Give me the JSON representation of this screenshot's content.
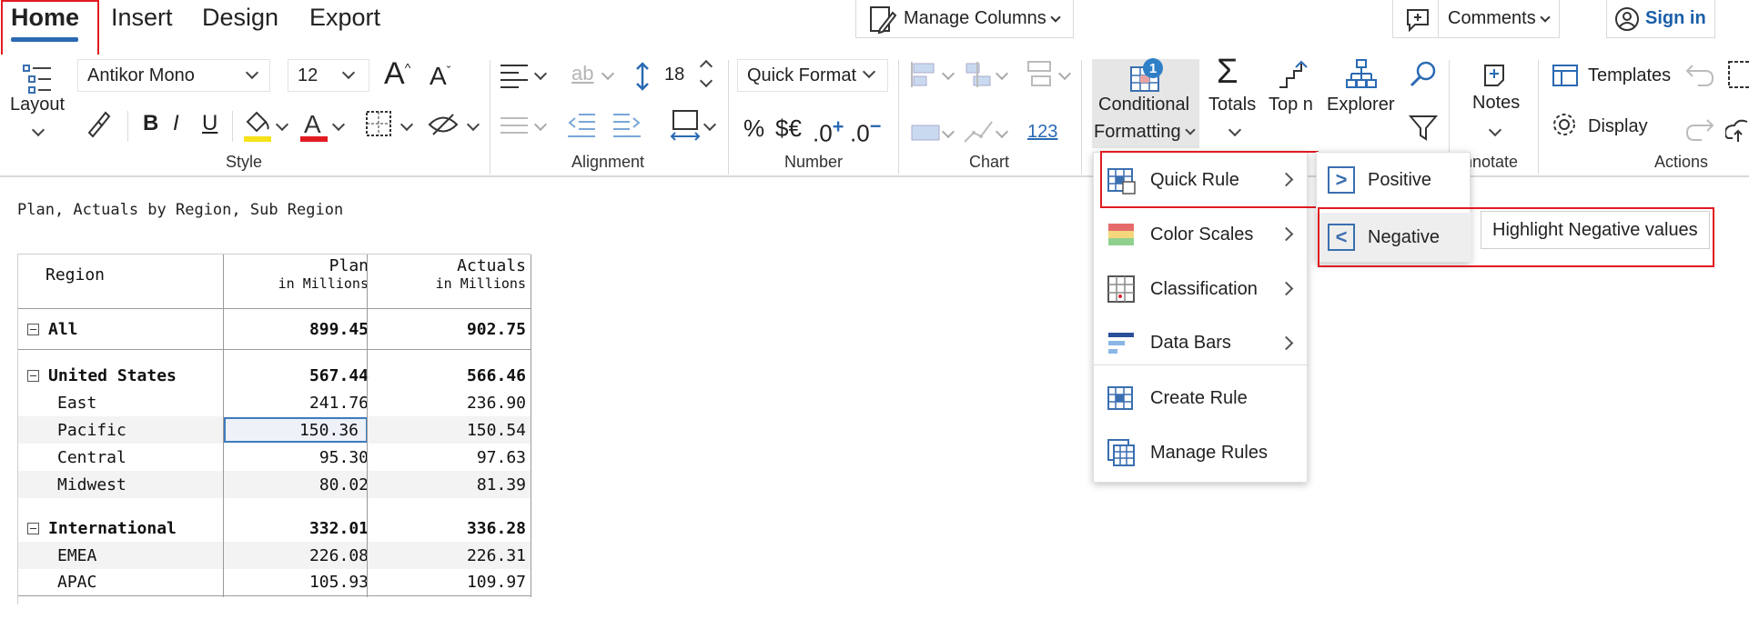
{
  "tabs": {
    "home": "Home",
    "insert": "Insert",
    "design": "Design",
    "export": "Export"
  },
  "top": {
    "manage_columns": "Manage Columns",
    "comments": "Comments",
    "sign_in": "Sign in"
  },
  "ribbon": {
    "layout_label": "Layout",
    "font_name": "Antikor Mono",
    "font_size": "12",
    "bold": "B",
    "italic": "I",
    "underline": "U",
    "style_group": "Style",
    "line_height": "18",
    "alignment_group": "Alignment",
    "quick_format": "Quick Format",
    "percent": "%",
    "currency": "$€",
    "inc_decimal": ".0",
    "dec_decimal": ".0",
    "number_group": "Number",
    "chart_group": "Chart",
    "chart_123": "123",
    "cf_line1": "Conditional",
    "cf_line2": "Formatting",
    "cf_badge": "1",
    "totals": "Totals",
    "topn": "Top n",
    "explorer": "Explorer",
    "notes": "Notes",
    "annotate_group": "nnotate",
    "templates": "Templates",
    "display": "Display",
    "actions_group": "Actions"
  },
  "report": {
    "title": "Plan, Actuals by Region, Sub Region",
    "headers": {
      "region": "Region",
      "plan": "Plan",
      "plan_unit": "in Millions",
      "actuals": "Actuals",
      "actuals_unit": "in Millions"
    },
    "rows": [
      {
        "label": "All",
        "plan": "899.45",
        "actuals": "902.75"
      },
      {
        "label": "United States",
        "plan": "567.44",
        "actuals": "566.46"
      },
      {
        "label": "East",
        "plan": "241.76",
        "actuals": "236.90"
      },
      {
        "label": "Pacific",
        "plan": "150.36",
        "actuals": "150.54"
      },
      {
        "label": "Central",
        "plan": "95.30",
        "actuals": "97.63"
      },
      {
        "label": "Midwest",
        "plan": "80.02",
        "actuals": "81.39"
      },
      {
        "label": "International",
        "plan": "332.01",
        "actuals": "336.28"
      },
      {
        "label": "EMEA",
        "plan": "226.08",
        "actuals": "226.31"
      },
      {
        "label": "APAC",
        "plan": "105.93",
        "actuals": "109.97"
      }
    ]
  },
  "cf_menu": {
    "items": [
      "Quick Rule",
      "Color Scales",
      "Classification",
      "Data Bars",
      "Create Rule",
      "Manage Rules"
    ]
  },
  "quick_rule_menu": {
    "positive": "Positive",
    "negative": "Negative",
    "positive_glyph": ">",
    "negative_glyph": "<",
    "tooltip": "Highlight Negative values"
  },
  "colors": {
    "accent": "#2a6ab3",
    "highlight_red": "#e11b22",
    "font_red": "#e11b22",
    "fill_yellow": "#f5e21a"
  }
}
